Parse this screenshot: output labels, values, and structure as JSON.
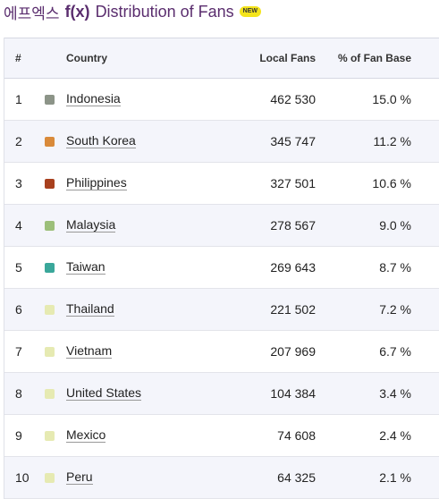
{
  "header": {
    "korean": "에프엑스",
    "fx": "f(x)",
    "title": "Distribution of Fans",
    "badge": "NEW"
  },
  "table": {
    "columns": {
      "rank": "#",
      "country": "Country",
      "fans": "Local Fans",
      "pct": "% of Fan Base"
    },
    "rows": [
      {
        "rank": "1",
        "country": "Indonesia",
        "fans": "462  530",
        "pct": "15.0 %",
        "color": "#8c9488"
      },
      {
        "rank": "2",
        "country": "South Korea",
        "fans": "345  747",
        "pct": "11.2 %",
        "color": "#d98a3a"
      },
      {
        "rank": "3",
        "country": "Philippines",
        "fans": "327  501",
        "pct": "10.6 %",
        "color": "#a8401e"
      },
      {
        "rank": "4",
        "country": "Malaysia",
        "fans": "278  567",
        "pct": "9.0 %",
        "color": "#9cbf7a"
      },
      {
        "rank": "5",
        "country": "Taiwan",
        "fans": "269  643",
        "pct": "8.7 %",
        "color": "#3aa79a"
      },
      {
        "rank": "6",
        "country": "Thailand",
        "fans": "221  502",
        "pct": "7.2 %",
        "color": "#e6eab2"
      },
      {
        "rank": "7",
        "country": "Vietnam",
        "fans": "207  969",
        "pct": "6.7 %",
        "color": "#e6eab2"
      },
      {
        "rank": "8",
        "country": "United States",
        "fans": "104  384",
        "pct": "3.4 %",
        "color": "#e6eab2"
      },
      {
        "rank": "9",
        "country": "Mexico",
        "fans": "74  608",
        "pct": "2.4 %",
        "color": "#e6eab2"
      },
      {
        "rank": "10",
        "country": "Peru",
        "fans": "64  325",
        "pct": "2.1 %",
        "color": "#e6eab2"
      }
    ]
  }
}
